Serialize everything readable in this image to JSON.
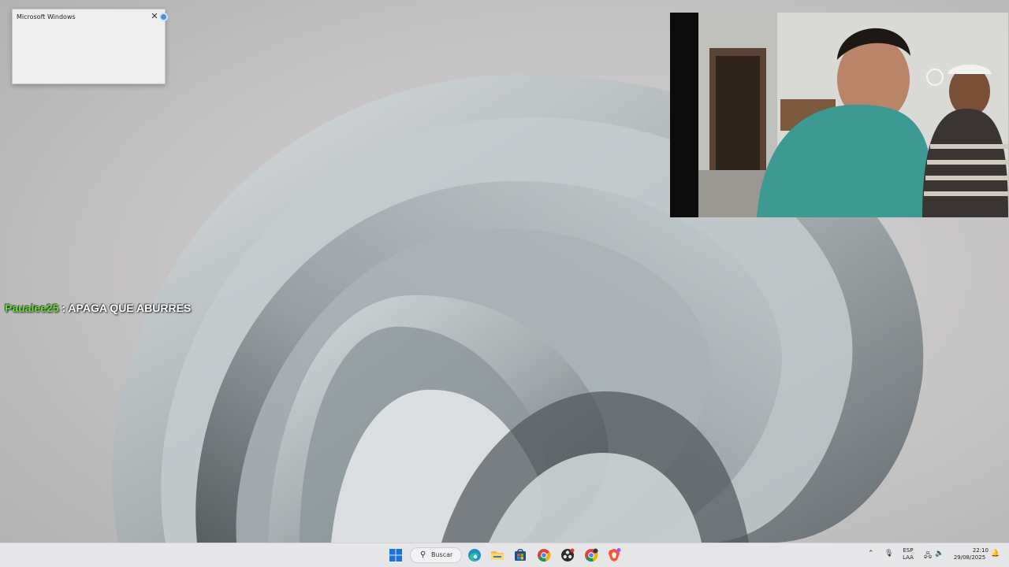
{
  "dialog": {
    "title": "Microsoft Windows",
    "close_glyph": "✕"
  },
  "chat": {
    "username": "Paualee25",
    "separator": " : ",
    "message": "APAGA QUE ABURRES",
    "username_color": "#66dd33"
  },
  "taskbar": {
    "search_label": "Buscar",
    "search_icon": "search-icon",
    "apps": [
      {
        "name": "start-icon"
      },
      {
        "name": "edge-icon"
      },
      {
        "name": "file-explorer-icon"
      },
      {
        "name": "store-icon"
      },
      {
        "name": "chrome-icon"
      },
      {
        "name": "obs-icon"
      },
      {
        "name": "chrome-profile-icon"
      },
      {
        "name": "brave-icon"
      }
    ],
    "tray": {
      "language_top": "ESP",
      "language_bottom": "LAA",
      "time": "22:10",
      "date": "29/08/2025"
    }
  },
  "colors": {
    "accent": "#0a64c8",
    "taskbar_bg": "#e6e6e9"
  }
}
